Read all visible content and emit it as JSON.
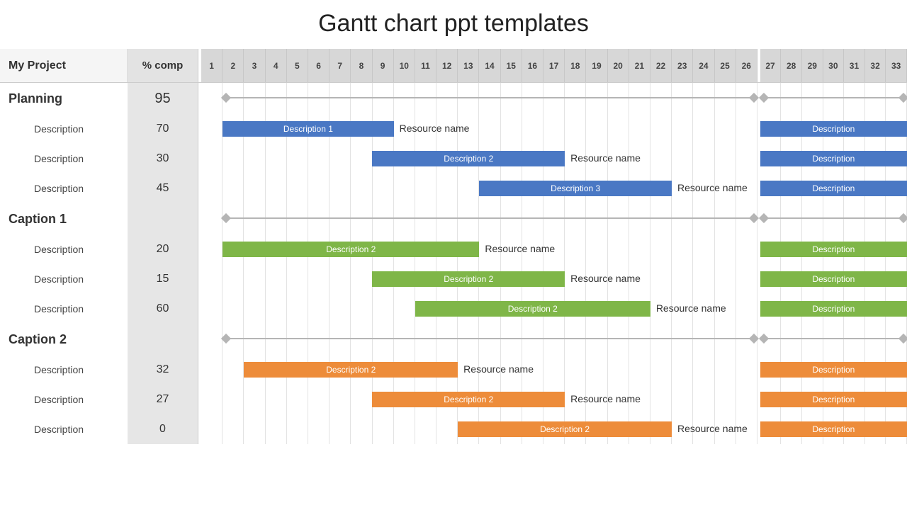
{
  "title": "Gantt chart ppt templates",
  "headers": {
    "project": "My Project",
    "comp": "% comp"
  },
  "timeline": {
    "main_cols": 26,
    "side_cols": 7,
    "side_start": 27
  },
  "groups": [
    {
      "name": "Planning",
      "comp": "95",
      "color": "blue",
      "tasks": [
        {
          "label": "Description",
          "comp": "70",
          "bar_label": "Description 1",
          "start": 2,
          "span": 8,
          "resource": "Resource name",
          "side_label": "Description"
        },
        {
          "label": "Description",
          "comp": "30",
          "bar_label": "Description 2",
          "start": 9,
          "span": 9,
          "resource": "Resource name",
          "side_label": "Description"
        },
        {
          "label": "Description",
          "comp": "45",
          "bar_label": "Description 3",
          "start": 14,
          "span": 9,
          "resource": "Resource name",
          "side_label": "Description"
        }
      ]
    },
    {
      "name": "Caption 1",
      "comp": "",
      "color": "green",
      "tasks": [
        {
          "label": "Description",
          "comp": "20",
          "bar_label": "Description 2",
          "start": 2,
          "span": 12,
          "resource": "Resource name",
          "side_label": "Description"
        },
        {
          "label": "Description",
          "comp": "15",
          "bar_label": "Description 2",
          "start": 9,
          "span": 9,
          "resource": "Resource name",
          "side_label": "Description"
        },
        {
          "label": "Description",
          "comp": "60",
          "bar_label": "Description 2",
          "start": 11,
          "span": 11,
          "resource": "Resource name",
          "side_label": "Description"
        }
      ]
    },
    {
      "name": "Caption 2",
      "comp": "",
      "color": "orange",
      "tasks": [
        {
          "label": "Description",
          "comp": "32",
          "bar_label": "Description 2",
          "start": 3,
          "span": 10,
          "resource": "Resource name",
          "side_label": "Description"
        },
        {
          "label": "Description",
          "comp": "27",
          "bar_label": "Description 2",
          "start": 9,
          "span": 9,
          "resource": "Resource name",
          "side_label": "Description"
        },
        {
          "label": "Description",
          "comp": "0",
          "bar_label": "Description 2",
          "start": 13,
          "span": 10,
          "resource": "Resource name",
          "side_label": "Description"
        }
      ]
    }
  ],
  "chart_data": {
    "type": "gantt",
    "title": "Gantt chart ppt templates",
    "x_range_main": [
      1,
      26
    ],
    "x_range_side": [
      27,
      33
    ],
    "groups": [
      {
        "name": "Planning",
        "percent_complete": 95,
        "tasks": [
          {
            "name": "Description 1",
            "percent_complete": 70,
            "start": 2,
            "end": 9,
            "resource": "Resource name"
          },
          {
            "name": "Description 2",
            "percent_complete": 30,
            "start": 9,
            "end": 17,
            "resource": "Resource name"
          },
          {
            "name": "Description 3",
            "percent_complete": 45,
            "start": 14,
            "end": 22,
            "resource": "Resource name"
          }
        ]
      },
      {
        "name": "Caption 1",
        "percent_complete": null,
        "tasks": [
          {
            "name": "Description 2",
            "percent_complete": 20,
            "start": 2,
            "end": 13,
            "resource": "Resource name"
          },
          {
            "name": "Description 2",
            "percent_complete": 15,
            "start": 9,
            "end": 17,
            "resource": "Resource name"
          },
          {
            "name": "Description 2",
            "percent_complete": 60,
            "start": 11,
            "end": 21,
            "resource": "Resource name"
          }
        ]
      },
      {
        "name": "Caption 2",
        "percent_complete": null,
        "tasks": [
          {
            "name": "Description 2",
            "percent_complete": 32,
            "start": 3,
            "end": 12,
            "resource": "Resource name"
          },
          {
            "name": "Description 2",
            "percent_complete": 27,
            "start": 9,
            "end": 17,
            "resource": "Resource name"
          },
          {
            "name": "Description 2",
            "percent_complete": 0,
            "end": 22,
            "start": 13,
            "resource": "Resource name"
          }
        ]
      }
    ]
  }
}
